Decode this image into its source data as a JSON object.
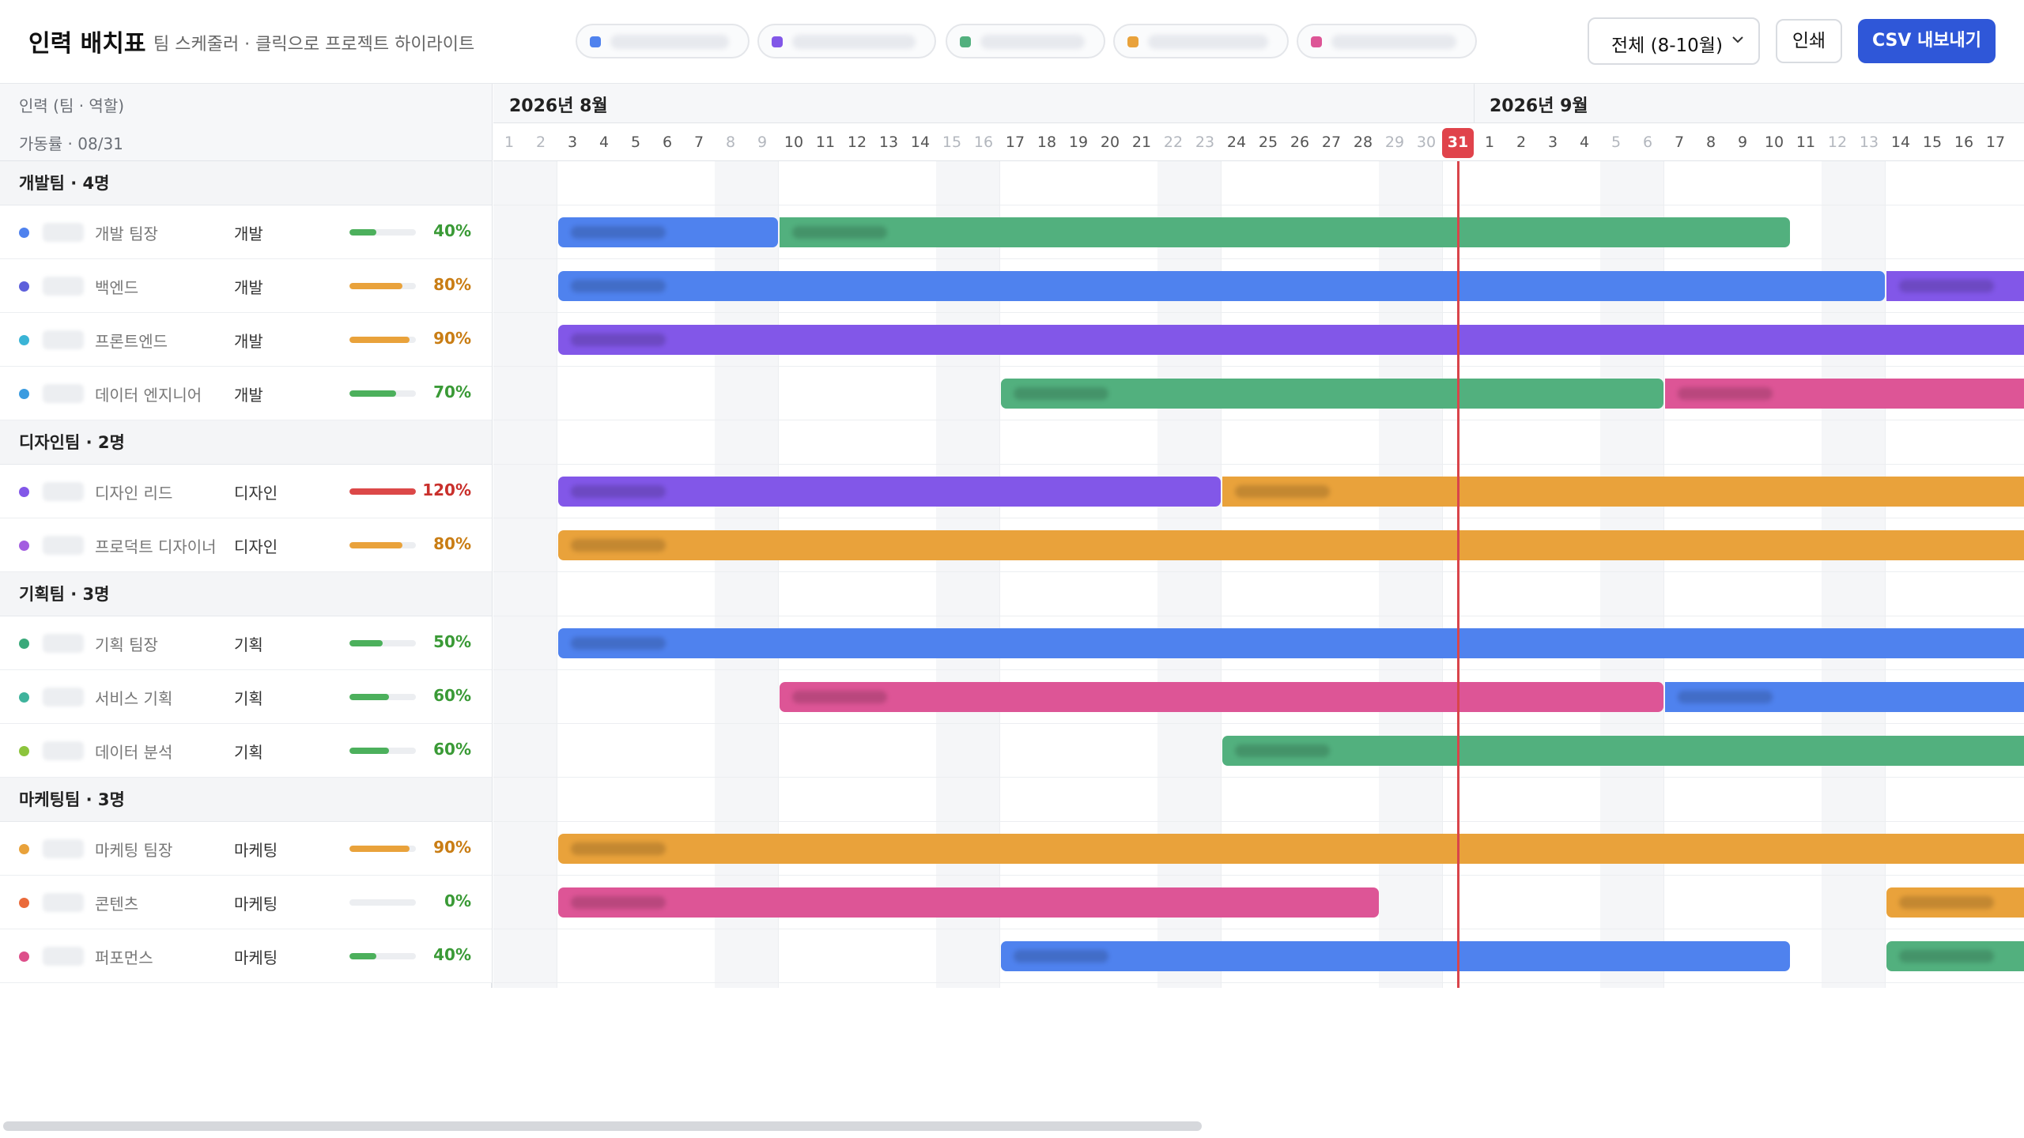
{
  "header": {
    "title": "인력 배치표",
    "subtitle": "팀 스케줄러 · 클릭으로 프로젝트 하이라이트",
    "filter_chips": [
      {
        "color": "#4f82ee"
      },
      {
        "color": "#8257e8"
      },
      {
        "color": "#52b07e"
      },
      {
        "color": "#e9a23b"
      },
      {
        "color": "#dd5596"
      }
    ],
    "range_select": "전체 (8-10월)",
    "print_label": "인쇄",
    "csv_label": "CSV 내보내기"
  },
  "left_header": {
    "col_label": "인력 (팀 · 역할)",
    "util_label": "가동률 · 08/31"
  },
  "teams": [
    {
      "name": "개발팀 · 4명",
      "members": [
        {
          "role": "개발 팀장",
          "dept": "개발",
          "util": 40,
          "util_label": "40%",
          "dot": "#4f82ee"
        },
        {
          "role": "백엔드",
          "dept": "개발",
          "util": 80,
          "util_label": "80%",
          "dot": "#5d5fdb"
        },
        {
          "role": "프론트엔드",
          "dept": "개발",
          "util": 90,
          "util_label": "90%",
          "dot": "#3ab4d6"
        },
        {
          "role": "데이터 엔지니어",
          "dept": "개발",
          "util": 70,
          "util_label": "70%",
          "dot": "#3a9be0"
        }
      ]
    },
    {
      "name": "디자인팀 · 2명",
      "members": [
        {
          "role": "디자인 리드",
          "dept": "디자인",
          "util": 120,
          "util_label": "120%",
          "dot": "#8257e8"
        },
        {
          "role": "프로덕트 디자이너",
          "dept": "디자인",
          "util": 80,
          "util_label": "80%",
          "dot": "#a35ee0"
        }
      ]
    },
    {
      "name": "기획팀 · 3명",
      "members": [
        {
          "role": "기획 팀장",
          "dept": "기획",
          "util": 50,
          "util_label": "50%",
          "dot": "#3aa97a"
        },
        {
          "role": "서비스 기획",
          "dept": "기획",
          "util": 60,
          "util_label": "60%",
          "dot": "#3fb39c"
        },
        {
          "role": "데이터 분석",
          "dept": "기획",
          "util": 60,
          "util_label": "60%",
          "dot": "#8cc43c"
        }
      ]
    },
    {
      "name": "마케팅팀 · 3명",
      "members": [
        {
          "role": "마케팅 팀장",
          "dept": "마케팅",
          "util": 90,
          "util_label": "90%",
          "dot": "#e9a23b"
        },
        {
          "role": "콘텐츠",
          "dept": "마케팅",
          "util": 0,
          "util_label": "0%",
          "dot": "#ea6a3a"
        },
        {
          "role": "퍼포먼스",
          "dept": "마케팅",
          "util": 40,
          "util_label": "40%",
          "dot": "#dd4f8a"
        }
      ]
    }
  ],
  "timeline": {
    "months": [
      {
        "label": "2026년 8월",
        "start_day_index": 0
      },
      {
        "label": "2026년 9월",
        "start_day_index": 31
      }
    ],
    "days": [
      "1",
      "2",
      "3",
      "4",
      "5",
      "6",
      "7",
      "8",
      "9",
      "10",
      "11",
      "12",
      "13",
      "14",
      "15",
      "16",
      "17",
      "18",
      "19",
      "20",
      "21",
      "22",
      "23",
      "24",
      "25",
      "26",
      "27",
      "28",
      "29",
      "30",
      "31",
      "1",
      "2",
      "3",
      "4",
      "5",
      "6",
      "7",
      "8",
      "9",
      "10",
      "11",
      "12",
      "13",
      "14",
      "15",
      "16",
      "17"
    ],
    "weekend_indices": [
      0,
      1,
      7,
      8,
      14,
      15,
      21,
      22,
      28,
      29,
      35,
      36,
      42,
      43
    ],
    "today_index": 30,
    "bars": [
      [
        {
          "start": 2,
          "end": 8,
          "color": "#4f82ee"
        },
        {
          "start": 9,
          "end": 40,
          "color": "#52b07e"
        }
      ],
      [
        {
          "start": 2,
          "end": 43,
          "color": "#4f82ee"
        },
        {
          "start": 44,
          "end": 48,
          "color": "#8257e8"
        }
      ],
      [
        {
          "start": 2,
          "end": 48,
          "color": "#8257e8"
        }
      ],
      [
        {
          "start": 16,
          "end": 36,
          "color": "#52b07e"
        },
        {
          "start": 37,
          "end": 48,
          "color": "#dd5596"
        }
      ],
      [
        {
          "start": 2,
          "end": 22,
          "color": "#8257e8"
        },
        {
          "start": 23,
          "end": 48,
          "color": "#e9a23b"
        }
      ],
      [
        {
          "start": 2,
          "end": 48,
          "color": "#e9a23b"
        }
      ],
      [
        {
          "start": 2,
          "end": 48,
          "color": "#4f82ee"
        }
      ],
      [
        {
          "start": 9,
          "end": 36,
          "color": "#dd5596"
        },
        {
          "start": 37,
          "end": 48,
          "color": "#4f82ee"
        }
      ],
      [
        {
          "start": 23,
          "end": 48,
          "color": "#52b07e"
        }
      ],
      [
        {
          "start": 2,
          "end": 48,
          "color": "#e9a23b"
        }
      ],
      [
        {
          "start": 2,
          "end": 27,
          "color": "#dd5596"
        },
        {
          "start": 44,
          "end": 48,
          "color": "#e9a23b"
        }
      ],
      [
        {
          "start": 16,
          "end": 40,
          "color": "#4f82ee"
        },
        {
          "start": 44,
          "end": 48,
          "color": "#52b07e"
        }
      ]
    ]
  },
  "colors": {
    "util_ok": "#4cb05c",
    "util_warn": "#e9a23b",
    "util_over": "#dc4848",
    "pct_ok": "#3a9a36",
    "pct_warn": "#c97d14",
    "pct_over": "#c9302c",
    "today": "#d9454b"
  }
}
